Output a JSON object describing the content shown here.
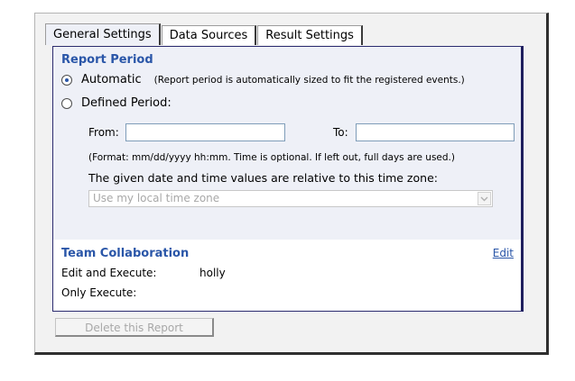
{
  "tabs": [
    {
      "label": "General Settings",
      "active": true
    },
    {
      "label": "Data Sources",
      "active": false
    },
    {
      "label": "Result Settings",
      "active": false
    }
  ],
  "report_period": {
    "title": "Report Period",
    "automatic_label": "Automatic",
    "automatic_hint": "(Report period is automatically sized to fit the registered events.)",
    "automatic_selected": true,
    "defined_label": "Defined Period:",
    "from_label": "From:",
    "from_value": "",
    "to_label": "To:",
    "to_value": "",
    "format_note": "(Format: mm/dd/yyyy hh:mm. Time is optional. If left out, full days are used.)",
    "timezone_note": "The given date and time values are relative to this time zone:",
    "timezone_selected": "Use my local time zone"
  },
  "team_collaboration": {
    "title": "Team Collaboration",
    "edit_link": "Edit",
    "edit_execute_label": "Edit and Execute:",
    "edit_execute_value": "holly",
    "only_execute_label": "Only Execute:",
    "only_execute_value": ""
  },
  "actions": {
    "delete_label": "Delete this Report"
  },
  "colors": {
    "accent": "#2a56a8",
    "section_bg": "#eef0f7",
    "disabled_text": "#a8a8a8"
  }
}
